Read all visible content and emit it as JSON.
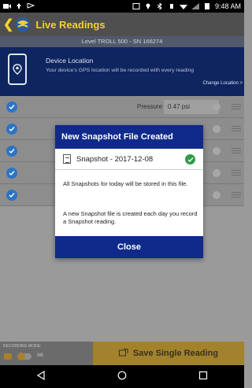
{
  "status_bar": {
    "time": "9:48 AM"
  },
  "app_bar": {
    "back_icon": "chevron-left",
    "title": "Live Readings",
    "accent": "#f2d22e"
  },
  "device_bar": {
    "label": "Level TROLL 500 - SN 166274"
  },
  "device_location": {
    "title": "Device Location",
    "description": "Your device's GPS location will be recorded with every reading",
    "change_link": "Change Location >"
  },
  "readings": [
    {
      "parameter": "Pressure",
      "value": "0.47 psi",
      "checked": true
    },
    {
      "parameter": "",
      "value": "",
      "checked": true
    },
    {
      "parameter": "",
      "value": "",
      "checked": true
    },
    {
      "parameter": "",
      "value": "",
      "checked": true
    },
    {
      "parameter": "",
      "value": "",
      "checked": true
    }
  ],
  "recording_mode": {
    "label": "RECORDING MODE:"
  },
  "save_button": {
    "label": "Save Single Reading"
  },
  "dialog": {
    "title": "New Snapshot File Created",
    "file_name": "Snapshot - 2017-12-08",
    "message_1": "All Snapshots for today will be stored in this file.",
    "message_2": "A new Snapshot file is created each day you record a Snapshot reading.",
    "close_label": "Close",
    "header_color": "#0f2a8a"
  }
}
